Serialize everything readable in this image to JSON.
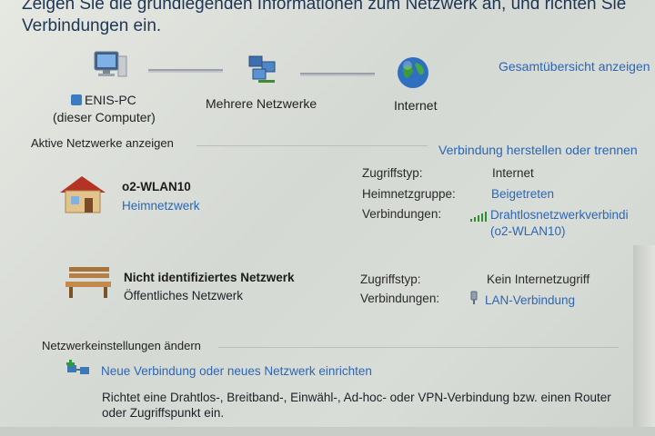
{
  "header": {
    "line1": "Zeigen Sie die grundlegenden Informationen zum Netzwerk an, und richten Sie",
    "line2": "Verbindungen ein."
  },
  "map": {
    "computer_name": "ENIS-PC",
    "computer_sub": "(dieser Computer)",
    "multi_label": "Mehrere Netzwerke",
    "internet_label": "Internet",
    "full_map_link": "Gesamtübersicht anzeigen"
  },
  "active": {
    "title": "Aktive Netzwerke anzeigen",
    "connect_link": "Verbindung herstellen oder trennen"
  },
  "network1": {
    "name": "o2-WLAN10",
    "type_link": "Heimnetzwerk",
    "access_key": "Zugriffstyp:",
    "access_val": "Internet",
    "homegroup_key": "Heimnetzgruppe:",
    "homegroup_val": "Beigetreten",
    "conn_key": "Verbindungen:",
    "conn_val_line1": "Drahtlosnetzwerkverbindi",
    "conn_val_line2": "(o2-WLAN10)"
  },
  "network2": {
    "name": "Nicht identifiziertes Netzwerk",
    "type": "Öffentliches Netzwerk",
    "access_key": "Zugriffstyp:",
    "access_val": "Kein Internetzugriff",
    "conn_key": "Verbindungen:",
    "conn_val": "LAN-Verbindung"
  },
  "settings": {
    "title": "Netzwerkeinstellungen ändern",
    "new_conn_link": "Neue Verbindung oder neues Netzwerk einrichten",
    "desc_line1": "Richtet eine Drahtlos-, Breitband-, Einwähl-, Ad-hoc- oder VPN-Verbindung bzw. einen Router",
    "desc_line2": "oder Zugriffspunkt ein."
  },
  "icons": {
    "computer": "computer-icon",
    "multi_network": "multiple-networks-icon",
    "internet": "globe-icon",
    "home": "house-icon",
    "public": "park-bench-icon",
    "wifi": "wifi-signal-icon",
    "lan": "lan-plug-icon",
    "new_connection": "new-connection-icon"
  },
  "colors": {
    "link": "#2c66b8",
    "heading": "#1f3554"
  }
}
